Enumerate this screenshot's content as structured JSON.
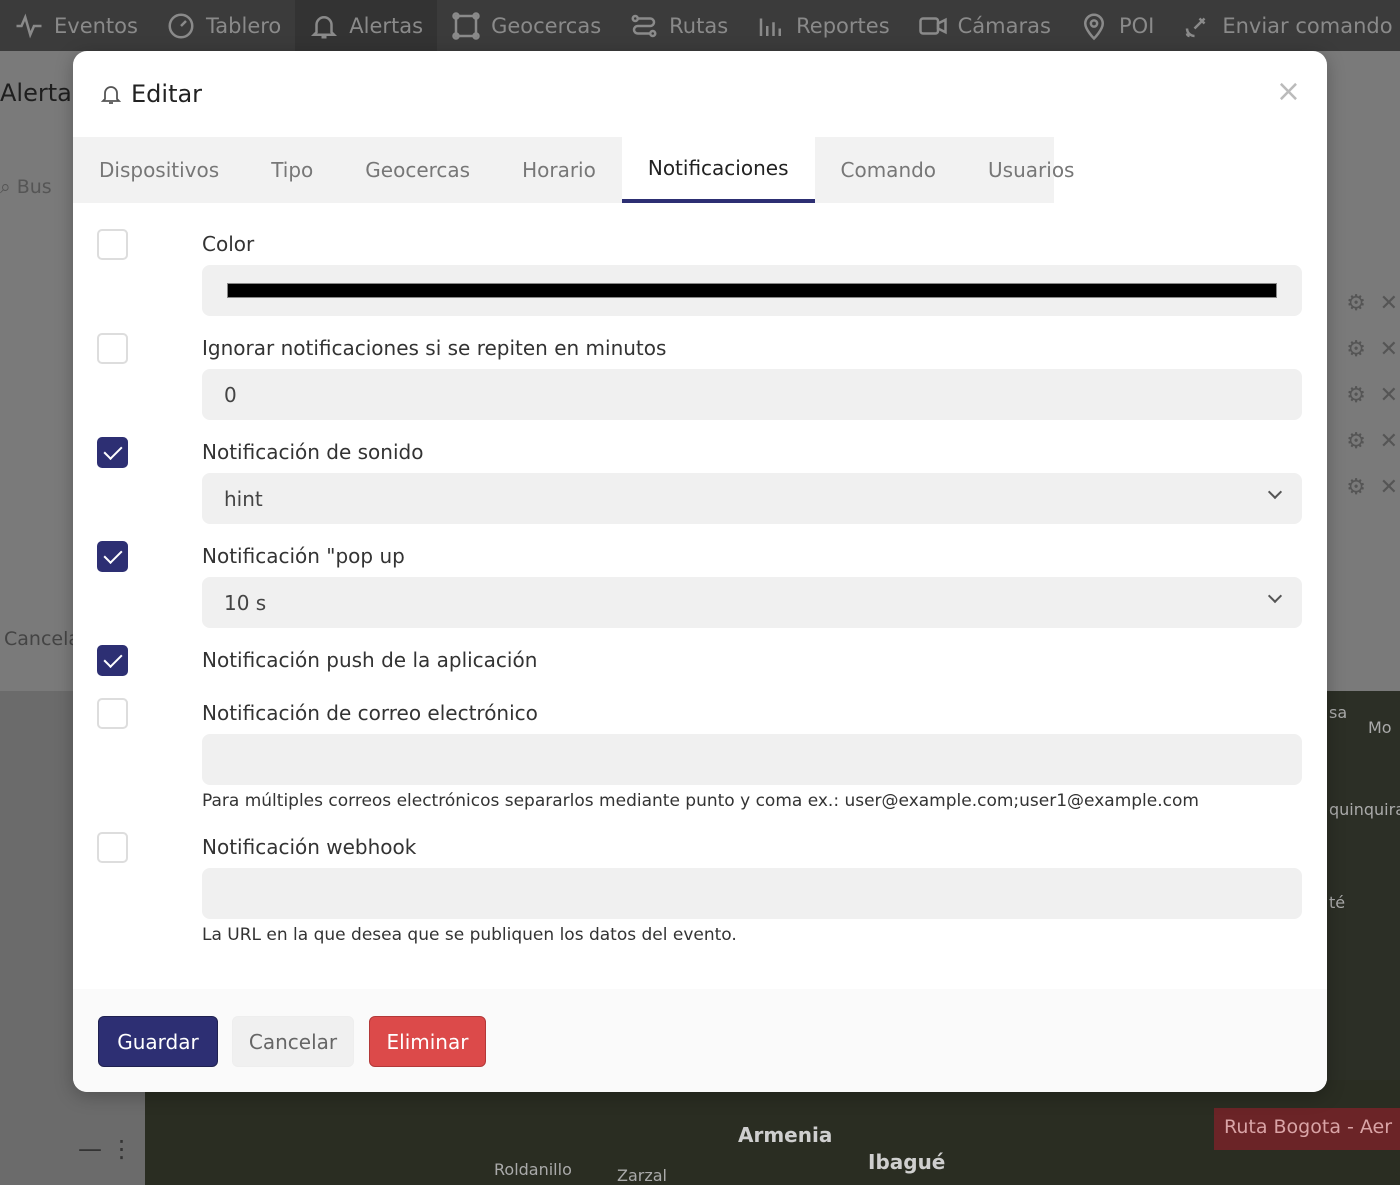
{
  "nav": {
    "items": [
      {
        "label": "Eventos",
        "icon": "activity-icon"
      },
      {
        "label": "Tablero",
        "icon": "gauge-icon"
      },
      {
        "label": "Alertas",
        "icon": "bell-icon",
        "active": true
      },
      {
        "label": "Geocercas",
        "icon": "polygon-icon"
      },
      {
        "label": "Rutas",
        "icon": "route-icon"
      },
      {
        "label": "Reportes",
        "icon": "bar-chart-icon"
      },
      {
        "label": "Cámaras",
        "icon": "camera-icon"
      },
      {
        "label": "POI",
        "icon": "map-pin-icon"
      },
      {
        "label": "Enviar comando",
        "icon": "satellite-icon"
      }
    ]
  },
  "background": {
    "panel_title": "Alerta",
    "search_placeholder": "Bus",
    "cancel_label": "Cancela",
    "map_labels": [
      "Armenia",
      "Ibagué",
      "Roldanillo",
      "Zarzal",
      "Mo",
      "quinquira",
      "té",
      "sa"
    ],
    "route_chip": "Ruta Bogota - Aer"
  },
  "modal": {
    "title": "Editar",
    "close_symbol": "×",
    "tabs": [
      "Dispositivos",
      "Tipo",
      "Geocercas",
      "Horario",
      "Notificaciones",
      "Comando",
      "Usuarios"
    ],
    "active_tab": "Notificaciones",
    "fields": {
      "color": {
        "label": "Color",
        "checked": false,
        "value": "#000000"
      },
      "ignore_repeat": {
        "label": "Ignorar notificaciones si se repiten en minutos",
        "checked": false,
        "value": "0"
      },
      "sound": {
        "label": "Notificación de sonido",
        "checked": true,
        "value": "hint"
      },
      "popup": {
        "label": "Notificación \"pop up",
        "checked": true,
        "value": "10 s"
      },
      "push": {
        "label": "Notificación push de la aplicación",
        "checked": true
      },
      "email": {
        "label": "Notificación de correo electrónico",
        "checked": false,
        "value": "",
        "help": "Para múltiples correos electrónicos separarlos mediante punto y coma ex.: user@example.com;user1@example.com"
      },
      "webhook": {
        "label": "Notificación webhook",
        "checked": false,
        "value": "",
        "help": "La URL en la que desea que se publiquen los datos del evento."
      }
    },
    "buttons": {
      "save": "Guardar",
      "cancel": "Cancelar",
      "delete": "Eliminar"
    }
  },
  "colors": {
    "primary": "#2d2f73",
    "danger": "#dc4a4a",
    "field_bg": "#f0f0f0"
  }
}
